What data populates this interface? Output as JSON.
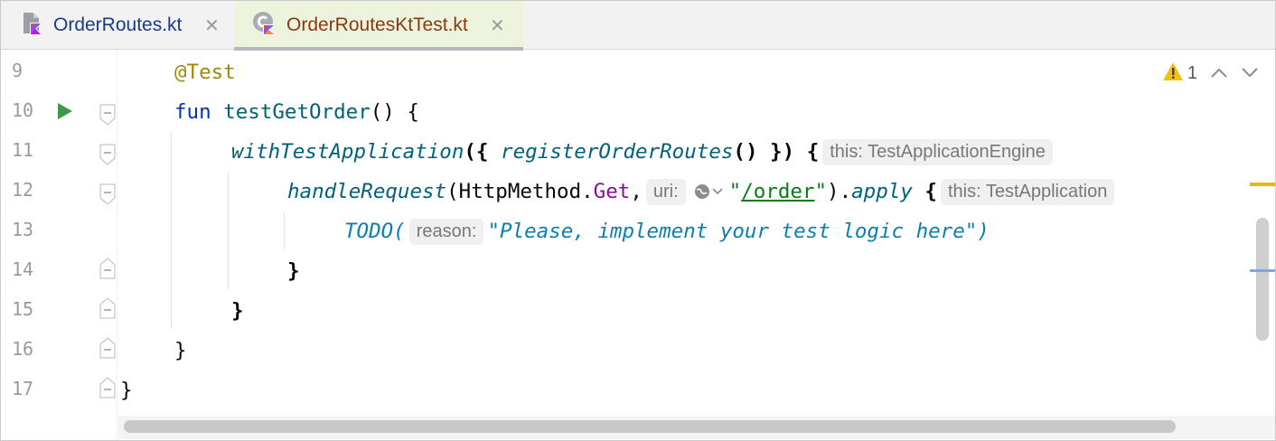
{
  "tabs": [
    {
      "label": "OrderRoutes.kt",
      "icon": "kotlin-file-icon",
      "active": false
    },
    {
      "label": "OrderRoutesKtTest.kt",
      "icon": "kotlin-test-file-icon",
      "active": true
    }
  ],
  "editor": {
    "line_numbers": [
      "9",
      "10",
      "11",
      "12",
      "13",
      "14",
      "15",
      "16",
      "17"
    ],
    "inspections": {
      "warnings": "1",
      "icon": "warning-icon"
    },
    "code": {
      "l9_annotation": "@Test",
      "l10_kw": "fun",
      "l10_name": "testGetOrder",
      "l10_rest": "() {",
      "l11_fn": "withTestApplication",
      "l11_open": "({",
      "l11_call": "registerOrderRoutes",
      "l11_close": "() }) {",
      "l11_hint": "this: TestApplicationEngine",
      "l12_fn": "handleRequest",
      "l12_args": "(HttpMethod.",
      "l12_get": "Get",
      "l12_comma": ",",
      "l12_hint_uri": "uri:",
      "l12_q1": "\"",
      "l12_path": "/order",
      "l12_q2": "\"",
      "l12_paren": ").",
      "l12_apply": "apply",
      "l12_brace": "{",
      "l12_hint_this": "this: TestApplication",
      "l13_todo": "TODO(",
      "l13_hint": "reason:",
      "l13_str": "\"Please, implement your test logic here\")",
      "l14": "}",
      "l15": "}",
      "l16": "}",
      "l17": "}"
    }
  },
  "colors": {
    "keyword": "#0033b3",
    "annotation": "#9e880d",
    "function": "#00627a",
    "string": "#067d17",
    "active_tab_bg": "#eef3dd"
  }
}
